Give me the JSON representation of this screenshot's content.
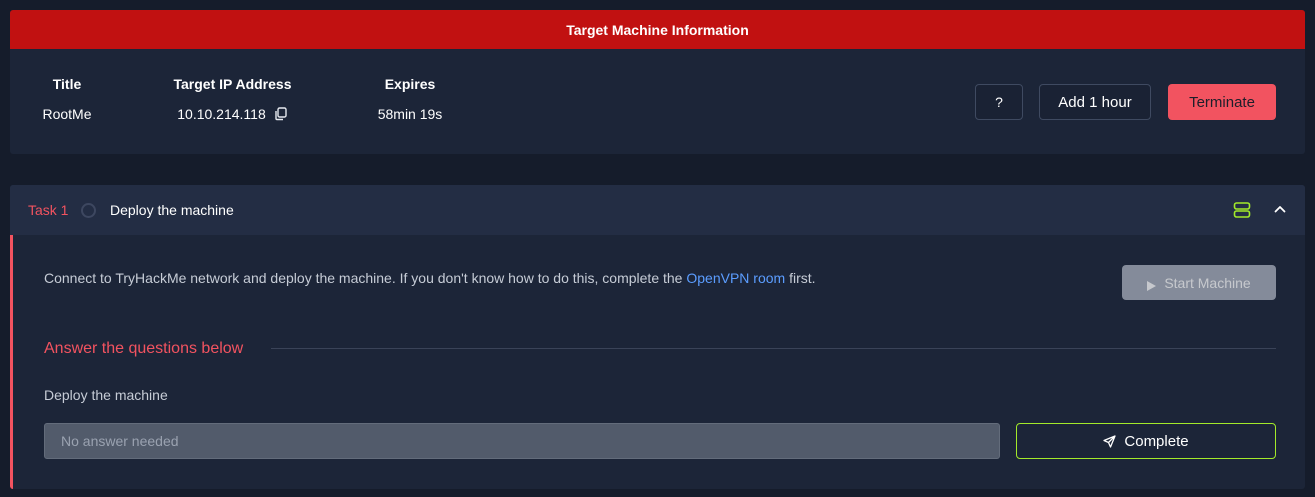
{
  "machine": {
    "header": "Target Machine Information",
    "columns": {
      "title_label": "Title",
      "title_value": "RootMe",
      "ip_label": "Target IP Address",
      "ip_value": "10.10.214.118",
      "expires_label": "Expires",
      "expires_value": "58min 19s"
    },
    "buttons": {
      "help": "?",
      "add_hour": "Add 1 hour",
      "terminate": "Terminate"
    },
    "colors": {
      "header": "#c11111",
      "terminate": "#f25360"
    }
  },
  "task": {
    "number": "Task 1",
    "title": "Deploy the machine",
    "description_before": "Connect to TryHackMe network and deploy the machine. If you don't know how to do this, complete the ",
    "description_link": "OpenVPN room",
    "description_after": " first.",
    "start_button": "Start Machine",
    "answer_heading": "Answer the questions below",
    "question": "Deploy the machine",
    "answer_placeholder": "No answer needed",
    "complete_button": "Complete",
    "icons": [
      "server-icon",
      "chevron-up-icon",
      "play-icon",
      "send-icon",
      "copy-icon"
    ],
    "colors": {
      "accent": "#f25360",
      "link": "#5b9dff",
      "complete_border": "#a3ea2a"
    }
  }
}
